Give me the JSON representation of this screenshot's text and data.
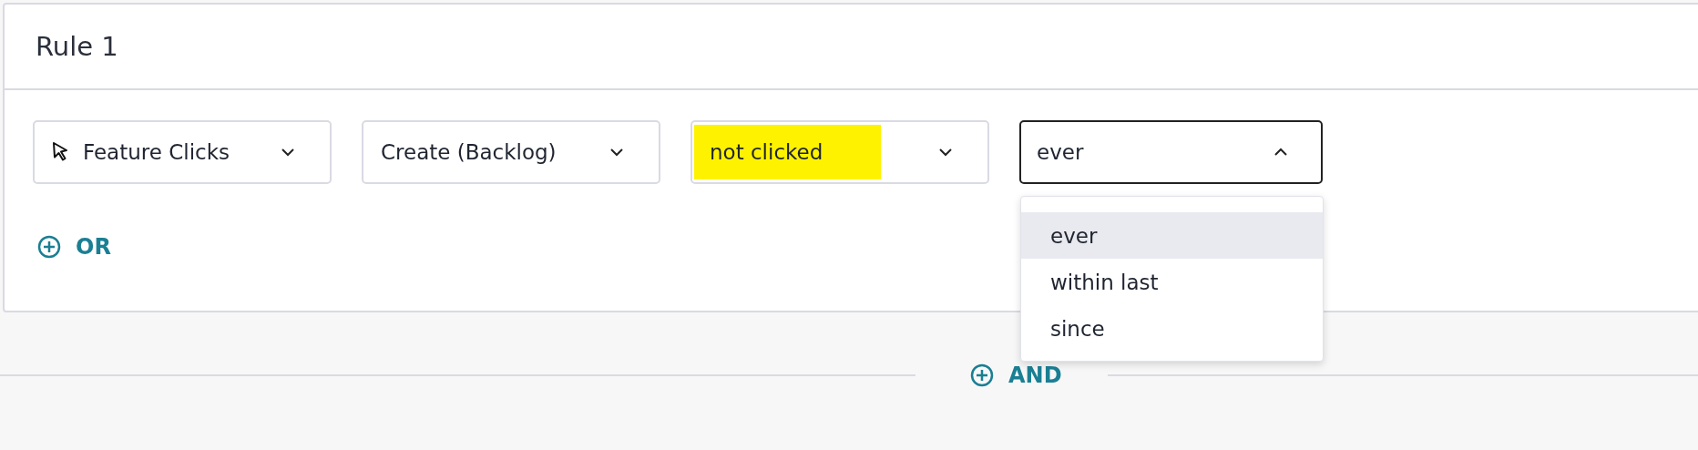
{
  "rule": {
    "title": "Rule 1",
    "conditions": [
      {
        "kind": "event",
        "value": "Feature Clicks",
        "open": false,
        "highlighted": false
      },
      {
        "kind": "plain",
        "value": "Create (Backlog)",
        "open": false,
        "highlighted": false
      },
      {
        "kind": "plain",
        "value": "not clicked",
        "open": false,
        "highlighted": true
      },
      {
        "kind": "plain",
        "value": "ever",
        "open": true,
        "highlighted": false,
        "options": [
          {
            "label": "ever",
            "selected": true
          },
          {
            "label": "within last",
            "selected": false
          },
          {
            "label": "since",
            "selected": false
          }
        ]
      }
    ],
    "or_button": "OR"
  },
  "and_button": "AND"
}
